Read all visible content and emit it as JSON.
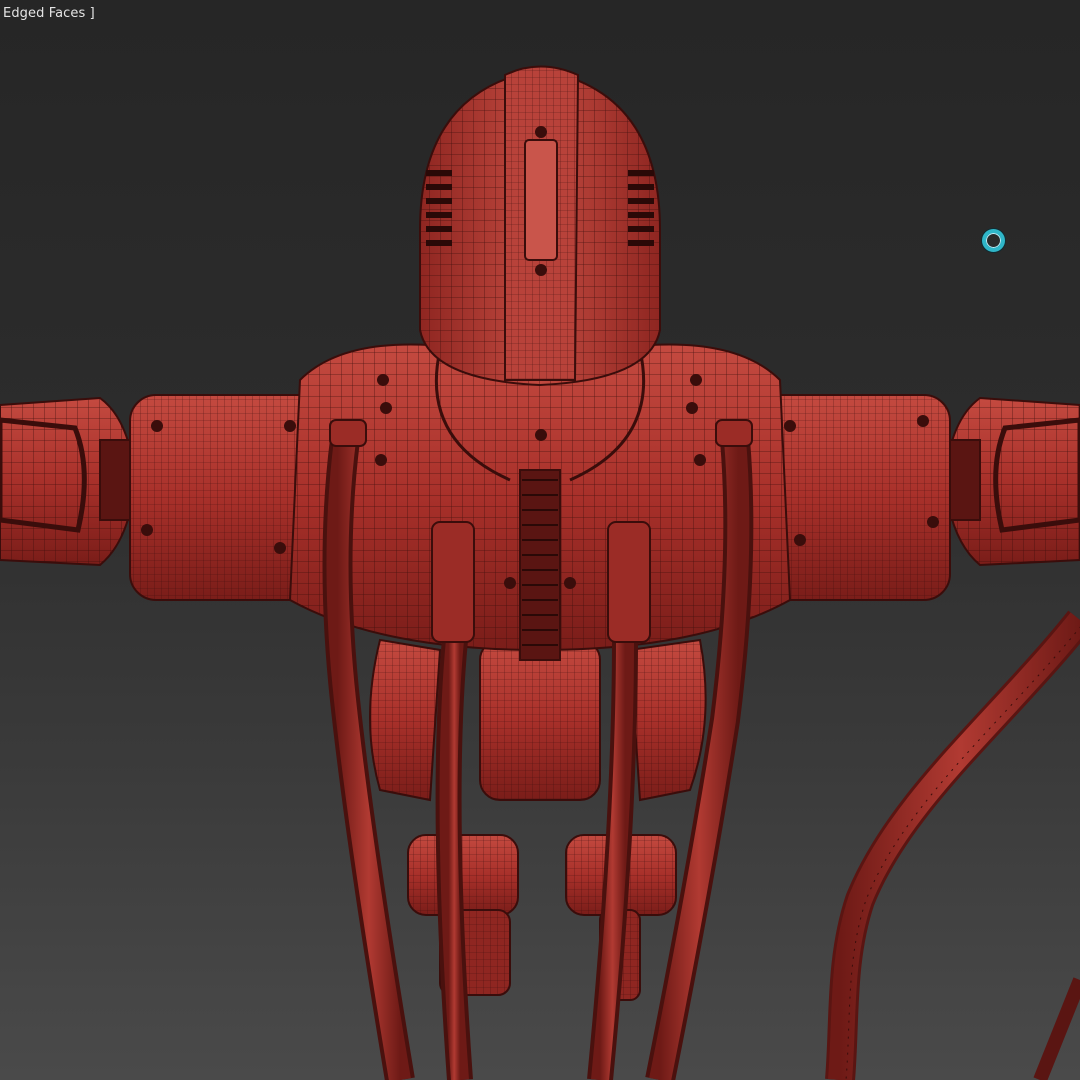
{
  "viewport": {
    "label": "Edged Faces ]",
    "background_top": "#262626",
    "background_bottom": "#4a4a4a"
  },
  "model": {
    "display_mode": "edged-faces",
    "shade_color": "#a8302a",
    "wire_color": "#3a0d0b"
  },
  "navigation_gizmo": {
    "icon": "orbit-ring-icon",
    "color": "#2fb6c8"
  }
}
